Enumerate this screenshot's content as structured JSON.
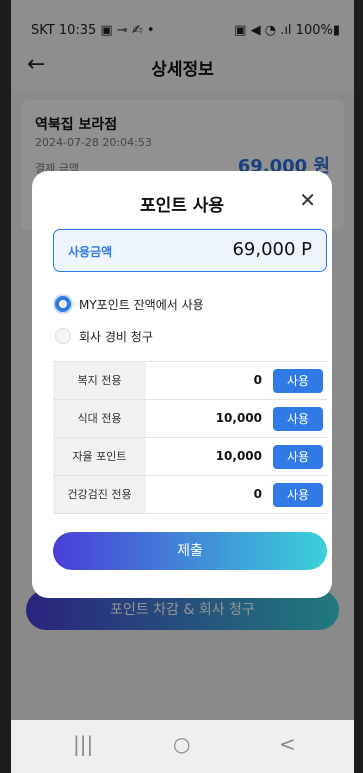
{
  "status_bar": {
    "left": "SKT 10:35 ▣ ⊸ ✍ •",
    "right": "▣ ◀ ◔ .ıl 100%▮"
  },
  "header": {
    "back_icon": "←",
    "title": "상세정보"
  },
  "store": {
    "name": "역북집 보라점",
    "datetime": "2024-07-28 20:04:53",
    "pay_label": "결제 금액",
    "pay_amount": "69,000 원"
  },
  "bottom_button": "포인트 차감 & 회사 청구",
  "modal": {
    "title": "포인트 사용",
    "close_icon": "✕",
    "amount_label": "사용금액",
    "amount_value": "69,000 P",
    "options": [
      {
        "label": "MY포인트 잔액에서 사용",
        "selected": true
      },
      {
        "label": "회사 경비 청구",
        "selected": false
      }
    ],
    "rows": [
      {
        "name": "복지 전용",
        "value": "0",
        "button": "사용"
      },
      {
        "name": "식대 전용",
        "value": "10,000",
        "button": "사용"
      },
      {
        "name": "자율 포인트",
        "value": "10,000",
        "button": "사용"
      },
      {
        "name": "건강검진 전용",
        "value": "0",
        "button": "사용"
      }
    ],
    "submit": "제출"
  },
  "nav_bar": {
    "recent_icon": "|||",
    "home_icon": "○",
    "back_icon": "<"
  },
  "colors": {
    "accent": "#2f7ae5",
    "gradient_start": "#4a3fd8",
    "gradient_end": "#3ad1d8"
  }
}
